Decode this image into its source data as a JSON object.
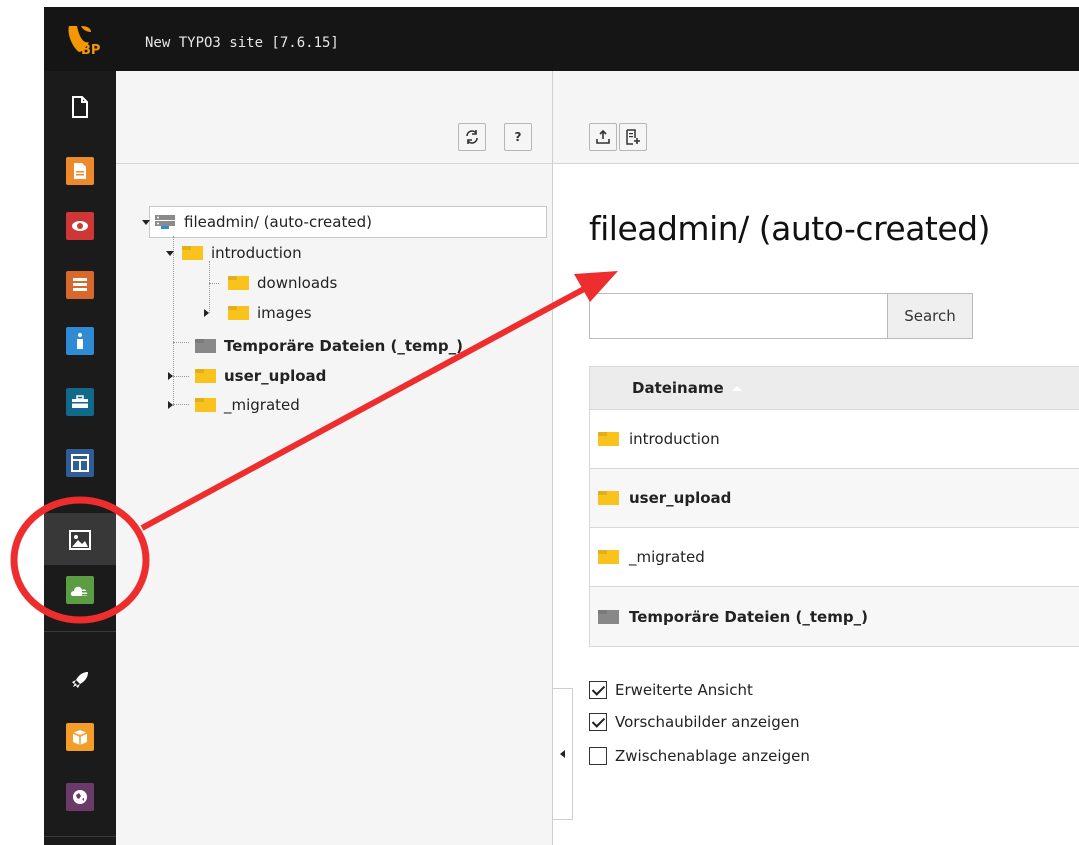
{
  "topbar": {
    "title": "New TYPO3 site [7.6.15]",
    "logo_text": "BP"
  },
  "modules": [
    {
      "name": "page",
      "icon": "document-icon",
      "color": "#1b1b1b"
    },
    {
      "name": "list",
      "icon": "page-orange-icon",
      "color": "#ee8a2b"
    },
    {
      "name": "view",
      "icon": "eye-icon",
      "color": "#cf3736"
    },
    {
      "name": "list2",
      "icon": "list-icon",
      "color": "#d8692e"
    },
    {
      "name": "info",
      "icon": "info-icon",
      "color": "#2f8bd4"
    },
    {
      "name": "functions",
      "icon": "briefcase-icon",
      "color": "#126a8b"
    },
    {
      "name": "template",
      "icon": "template-icon",
      "color": "#2e5d98"
    },
    {
      "name": "filelist",
      "icon": "image-icon",
      "color": "#383838"
    },
    {
      "name": "cloud",
      "icon": "cloud-icon",
      "color": "#5a9d42"
    },
    {
      "name": "rocket",
      "icon": "rocket-icon",
      "color": "#1b1b1b"
    },
    {
      "name": "extension",
      "icon": "box-icon",
      "color": "#f49d29"
    },
    {
      "name": "globe",
      "icon": "globe-icon",
      "color": "#6b3a6b"
    }
  ],
  "tree_toolbar": {
    "refresh_icon": "refresh-icon",
    "help_label": "?"
  },
  "tree": {
    "root": "fileadmin/ (auto-created)",
    "items": [
      {
        "label": "introduction",
        "bold": false
      },
      {
        "label": "downloads",
        "bold": false
      },
      {
        "label": "images",
        "bold": false
      },
      {
        "label": "Temporäre Dateien (_temp_)",
        "bold": true
      },
      {
        "label": "user_upload",
        "bold": true
      },
      {
        "label": "_migrated",
        "bold": false
      }
    ]
  },
  "content": {
    "heading": "fileadmin/ (auto-created)",
    "search": {
      "value": "",
      "button": "Search"
    },
    "table": {
      "header": "Dateiname",
      "rows": [
        {
          "label": "introduction",
          "bold": false,
          "folder_color": "yellow"
        },
        {
          "label": "user_upload",
          "bold": true,
          "folder_color": "yellow"
        },
        {
          "label": "_migrated",
          "bold": false,
          "folder_color": "yellow"
        },
        {
          "label": "Temporäre Dateien (_temp_)",
          "bold": true,
          "folder_color": "gray"
        }
      ]
    },
    "options": [
      {
        "label": "Erweiterte Ansicht",
        "checked": true
      },
      {
        "label": "Vorschaubilder anzeigen",
        "checked": true
      },
      {
        "label": "Zwischenablage anzeigen",
        "checked": false
      }
    ]
  },
  "annotation": {
    "color": "#ee2e2e"
  }
}
